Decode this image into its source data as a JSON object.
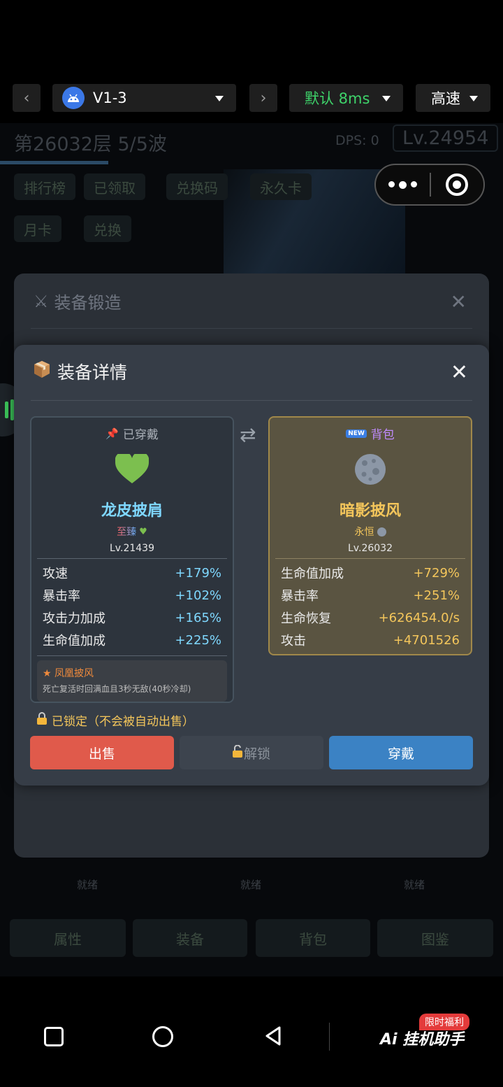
{
  "topbar": {
    "device": "V1-3",
    "network": "默认 8ms",
    "speed": "高速"
  },
  "game": {
    "floor": "第26032层 5/5波",
    "dps": "DPS: 0",
    "level": "Lv.24954",
    "buttons": [
      "排行榜",
      "已领取",
      "兑换码",
      "永久卡",
      "月卡",
      "兑换"
    ],
    "bottom_tabs": [
      "属性",
      "装备",
      "背包",
      "图鉴"
    ],
    "slot_states": [
      "就绪",
      "就绪",
      "就绪"
    ]
  },
  "forge": {
    "title": "装备锻造"
  },
  "detail": {
    "title": "装备详情",
    "equipped": {
      "tag": "已穿戴",
      "name": "龙皮披肩",
      "rarity": "至臻",
      "level": "Lv.21439",
      "stats": [
        {
          "label": "攻速",
          "value": "+179%"
        },
        {
          "label": "暴击率",
          "value": "+102%"
        },
        {
          "label": "攻击力加成",
          "value": "+165%"
        },
        {
          "label": "生命值加成",
          "value": "+225%"
        }
      ],
      "skill_name": "★ 凤凰披风",
      "skill_desc": "死亡复活时回满血且3秒无敌(40秒冷却)"
    },
    "bag": {
      "tag": "背包",
      "name": "暗影披风",
      "rarity": "永恒",
      "level": "Lv.26032",
      "stats": [
        {
          "label": "生命值加成",
          "value": "+729%"
        },
        {
          "label": "暴击率",
          "value": "+251%"
        },
        {
          "label": "生命恢复",
          "value": "+626454.0/s"
        },
        {
          "label": "攻击",
          "value": "+4701526"
        }
      ]
    },
    "locked_text": "已锁定（不会被自动出售）",
    "sell_label": "出售",
    "unlock_label": "解锁",
    "wear_label": "穿戴"
  },
  "navbar": {
    "promo": "Ai 挂机助手",
    "promo_badge": "限时福利"
  },
  "colors": {
    "equipped_accent": "#7fd8ff",
    "bag_accent": "#f4c65b",
    "sell": "#e05a4b",
    "wear": "#3b82c4"
  }
}
